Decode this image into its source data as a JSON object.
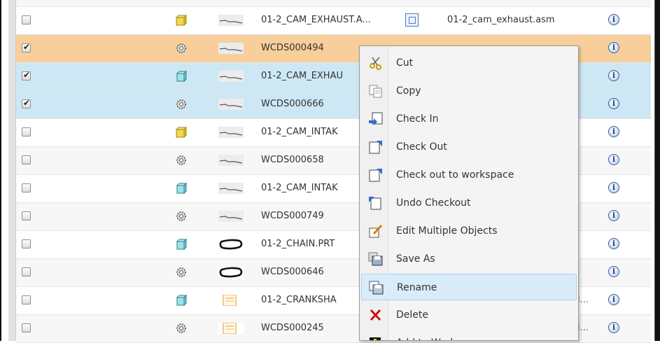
{
  "rows": [
    {
      "name": "01-2_CAM_EXHAUST.A...",
      "type": "assembly",
      "thumb": "line",
      "checked": false,
      "file": "01-2_cam_exhaust.asm",
      "trail": "",
      "link_icon": true,
      "state": "normal"
    },
    {
      "name": "WCDS000494",
      "type": "gear",
      "thumb": "line",
      "checked": true,
      "file": "",
      "trail": "",
      "link_icon": false,
      "state": "selected"
    },
    {
      "name": "01-2_CAM_EXHAU",
      "type": "part",
      "thumb": "line",
      "checked": true,
      "file": "",
      "trail": "",
      "link_icon": false,
      "state": "highlighted"
    },
    {
      "name": "WCDS000666",
      "type": "gear",
      "thumb": "line",
      "checked": true,
      "file": "",
      "trail": "",
      "link_icon": false,
      "state": "highlighted"
    },
    {
      "name": "01-2_CAM_INTAK",
      "type": "assembly",
      "thumb": "line",
      "checked": false,
      "file": "",
      "trail": "",
      "link_icon": false,
      "state": "normal"
    },
    {
      "name": "WCDS000658",
      "type": "gear",
      "thumb": "line",
      "checked": false,
      "file": "",
      "trail": "",
      "link_icon": false,
      "state": "normal"
    },
    {
      "name": "01-2_CAM_INTAK",
      "type": "part",
      "thumb": "line",
      "checked": false,
      "file": "",
      "trail": "",
      "link_icon": false,
      "state": "normal"
    },
    {
      "name": "WCDS000749",
      "type": "gear",
      "thumb": "line",
      "checked": false,
      "file": "",
      "trail": "",
      "link_icon": false,
      "state": "normal"
    },
    {
      "name": "01-2_CHAIN.PRT",
      "type": "part",
      "thumb": "chain",
      "checked": false,
      "file": "",
      "trail": "",
      "link_icon": false,
      "state": "normal"
    },
    {
      "name": "WCDS000646",
      "type": "gear",
      "thumb": "chain",
      "checked": false,
      "file": "",
      "trail": "",
      "link_icon": false,
      "state": "normal"
    },
    {
      "name": "01-2_CRANKSHA",
      "type": "part",
      "thumb": "document",
      "checked": false,
      "file": "",
      "trail": "l...",
      "link_icon": false,
      "state": "normal"
    },
    {
      "name": "WCDS000245",
      "type": "gear",
      "thumb": "document",
      "checked": false,
      "file": "",
      "trail": "l...",
      "link_icon": false,
      "state": "normal"
    }
  ],
  "context_menu": {
    "items": [
      {
        "label": "Cut",
        "icon": "scissors-icon"
      },
      {
        "label": "Copy",
        "icon": "copy-icon"
      },
      {
        "label": "Check In",
        "icon": "check-in-icon"
      },
      {
        "label": "Check Out",
        "icon": "check-out-icon"
      },
      {
        "label": "Check out to workspace",
        "icon": "check-out-workspace-icon"
      },
      {
        "label": "Undo Checkout",
        "icon": "undo-checkout-icon"
      },
      {
        "label": "Edit Multiple Objects",
        "icon": "edit-multiple-icon"
      },
      {
        "label": "Save As",
        "icon": "save-as-icon"
      },
      {
        "label": "Rename",
        "icon": "rename-icon"
      },
      {
        "label": "Delete",
        "icon": "delete-icon"
      },
      {
        "label": "Add to Workspace",
        "icon": "add-to-workspace-icon"
      }
    ],
    "active_label": "Rename"
  },
  "colors": {
    "selected_row": "#f8cf9a",
    "highlight_row": "#cde8f4",
    "menu_active": "#d9ecf9",
    "delete_x": "#cc1111"
  }
}
